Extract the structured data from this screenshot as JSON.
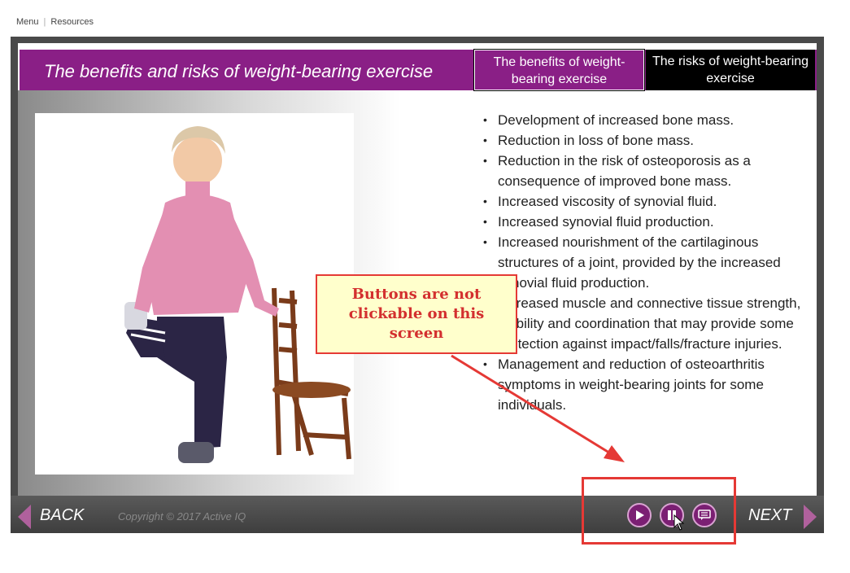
{
  "topnav": {
    "menu": "Menu",
    "resources": "Resources"
  },
  "header": {
    "title": "The benefits and risks of weight-bearing exercise"
  },
  "tabs": [
    {
      "label": "The benefits of weight-bearing exercise"
    },
    {
      "label": "The risks of weight-bearing exercise"
    }
  ],
  "bullets": [
    "Development of increased bone mass.",
    "Reduction in loss of bone mass.",
    "Reduction in the risk of osteoporosis as a consequence of improved bone mass.",
    "Increased viscosity of synovial fluid.",
    "Increased synovial fluid production.",
    "Increased nourishment of the cartilaginous structures of a joint, provided by the increased synovial fluid production.",
    "Increased muscle and connective tissue strength, stability and coordination that may provide some protection against impact/falls/fracture injuries.",
    "Management and reduction of osteoarthritis symptoms in weight-bearing joints for some individuals."
  ],
  "footer": {
    "back_label": "BACK",
    "next_label": "NEXT",
    "copyright": "Copyright © 2017 Active IQ"
  },
  "controls": {
    "icons": [
      "play-icon",
      "pause-icon",
      "comment-icon"
    ]
  },
  "callout": {
    "text": "Buttons are not clickable on this screen"
  },
  "colors": {
    "accent": "#8a1f86",
    "annotation": "#e53935",
    "callout_bg": "#ffffcc"
  }
}
